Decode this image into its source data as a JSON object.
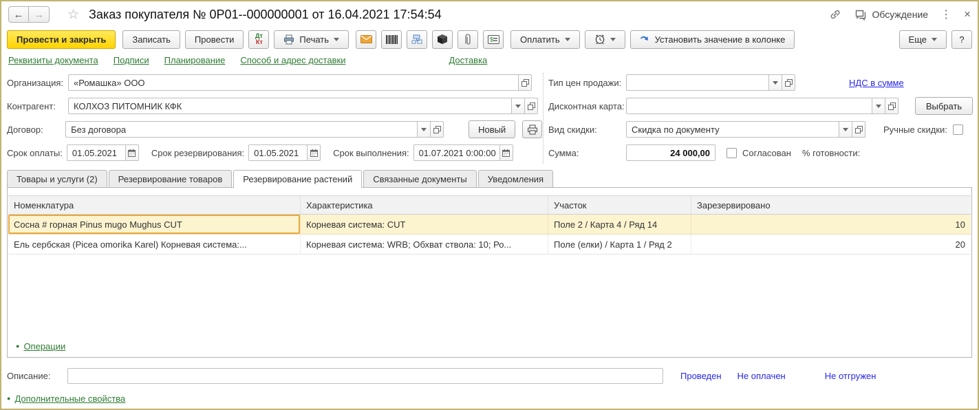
{
  "colors": {
    "accent_green": "#2E7D32",
    "link_blue": "#2626EE",
    "primary_button_yellow": "#FFD400",
    "selected_row_yellow": "#FCF3CF",
    "current_cell_border": "#E9A940",
    "window_border": "#C3B36E"
  },
  "icons": {
    "back": "←",
    "forward": "→",
    "star": "☆",
    "kebab": "⋮",
    "close": "×",
    "help": "?",
    "bullet": "●"
  },
  "header": {
    "title": "Заказ покупателя № 0Р01--000000001 от 16.04.2021 17:54:54",
    "discussion_label": "Обсуждение"
  },
  "toolbar": {
    "post_and_close": "Провести и закрыть",
    "save": "Записать",
    "post": "Провести",
    "dtkt_top": "Дт",
    "dtkt_bottom": "Кт",
    "print": "Печать",
    "pay": "Оплатить",
    "set_column_value": "Установить значение в колонке",
    "more": "Еще"
  },
  "nav_links": {
    "requisites": "Реквизиты документа",
    "signatures": "Подписи",
    "planning": "Планирование",
    "delivery_method": "Способ и адрес доставки",
    "delivery": "Доставка"
  },
  "form": {
    "organization": {
      "label": "Организация:",
      "value": "«Ромашка» ООО"
    },
    "counterparty": {
      "label": "Контрагент:",
      "value": "КОЛХОЗ ПИТОМНИК КФК"
    },
    "contract": {
      "label": "Договор:",
      "value": "Без договора",
      "new_button": "Новый"
    },
    "payment_due": {
      "label": "Срок оплаты:",
      "value": "01.05.2021"
    },
    "reserve_due": {
      "label": "Срок резервирования:",
      "value": "01.05.2021"
    },
    "fulfill_due": {
      "label": "Срок выполнения:",
      "value": "01.07.2021  0:00:00"
    },
    "price_type": {
      "label": "Тип цен продажи:",
      "value": ""
    },
    "vat_link": "НДС в сумме",
    "discount_card": {
      "label": "Дисконтная карта:",
      "value": "",
      "choose_button": "Выбрать"
    },
    "discount_kind": {
      "label": "Вид скидки:",
      "value": "Скидка по документу"
    },
    "manual_discounts_label": "Ручные скидки:",
    "amount": {
      "label": "Сумма:",
      "value": "24 000,00"
    },
    "approved_label": "Согласован",
    "readiness_label": "% готовности:"
  },
  "tabs": [
    {
      "label": "Товары и услуги (2)"
    },
    {
      "label": "Резервирование товаров"
    },
    {
      "label": "Резервирование растений"
    },
    {
      "label": "Связанные документы"
    },
    {
      "label": "Уведомления"
    }
  ],
  "table": {
    "headers": [
      "Номенклатура",
      "Характеристика",
      "Участок",
      "Зарезервировано"
    ],
    "rows": [
      [
        "Сосна # горная Pinus mugo Mughus CUT",
        "Корневая система: CUT",
        "Поле 2 / Карта 4 / Ряд 14",
        "10"
      ],
      [
        "Ель сербская (Picea omorika Karel) Корневая система:...",
        "Корневая система: WRB; Обхват ствола: 10; Ро...",
        "Поле (елки) / Карта 1 / Ряд 2",
        "20"
      ]
    ]
  },
  "footer": {
    "operations": "Операции",
    "description_label": "Описание:",
    "additional_properties": "Дополнительные свойства",
    "status_posted": "Проведен",
    "status_unpaid": "Не оплачен",
    "status_unshipped": "Не отгружен"
  }
}
